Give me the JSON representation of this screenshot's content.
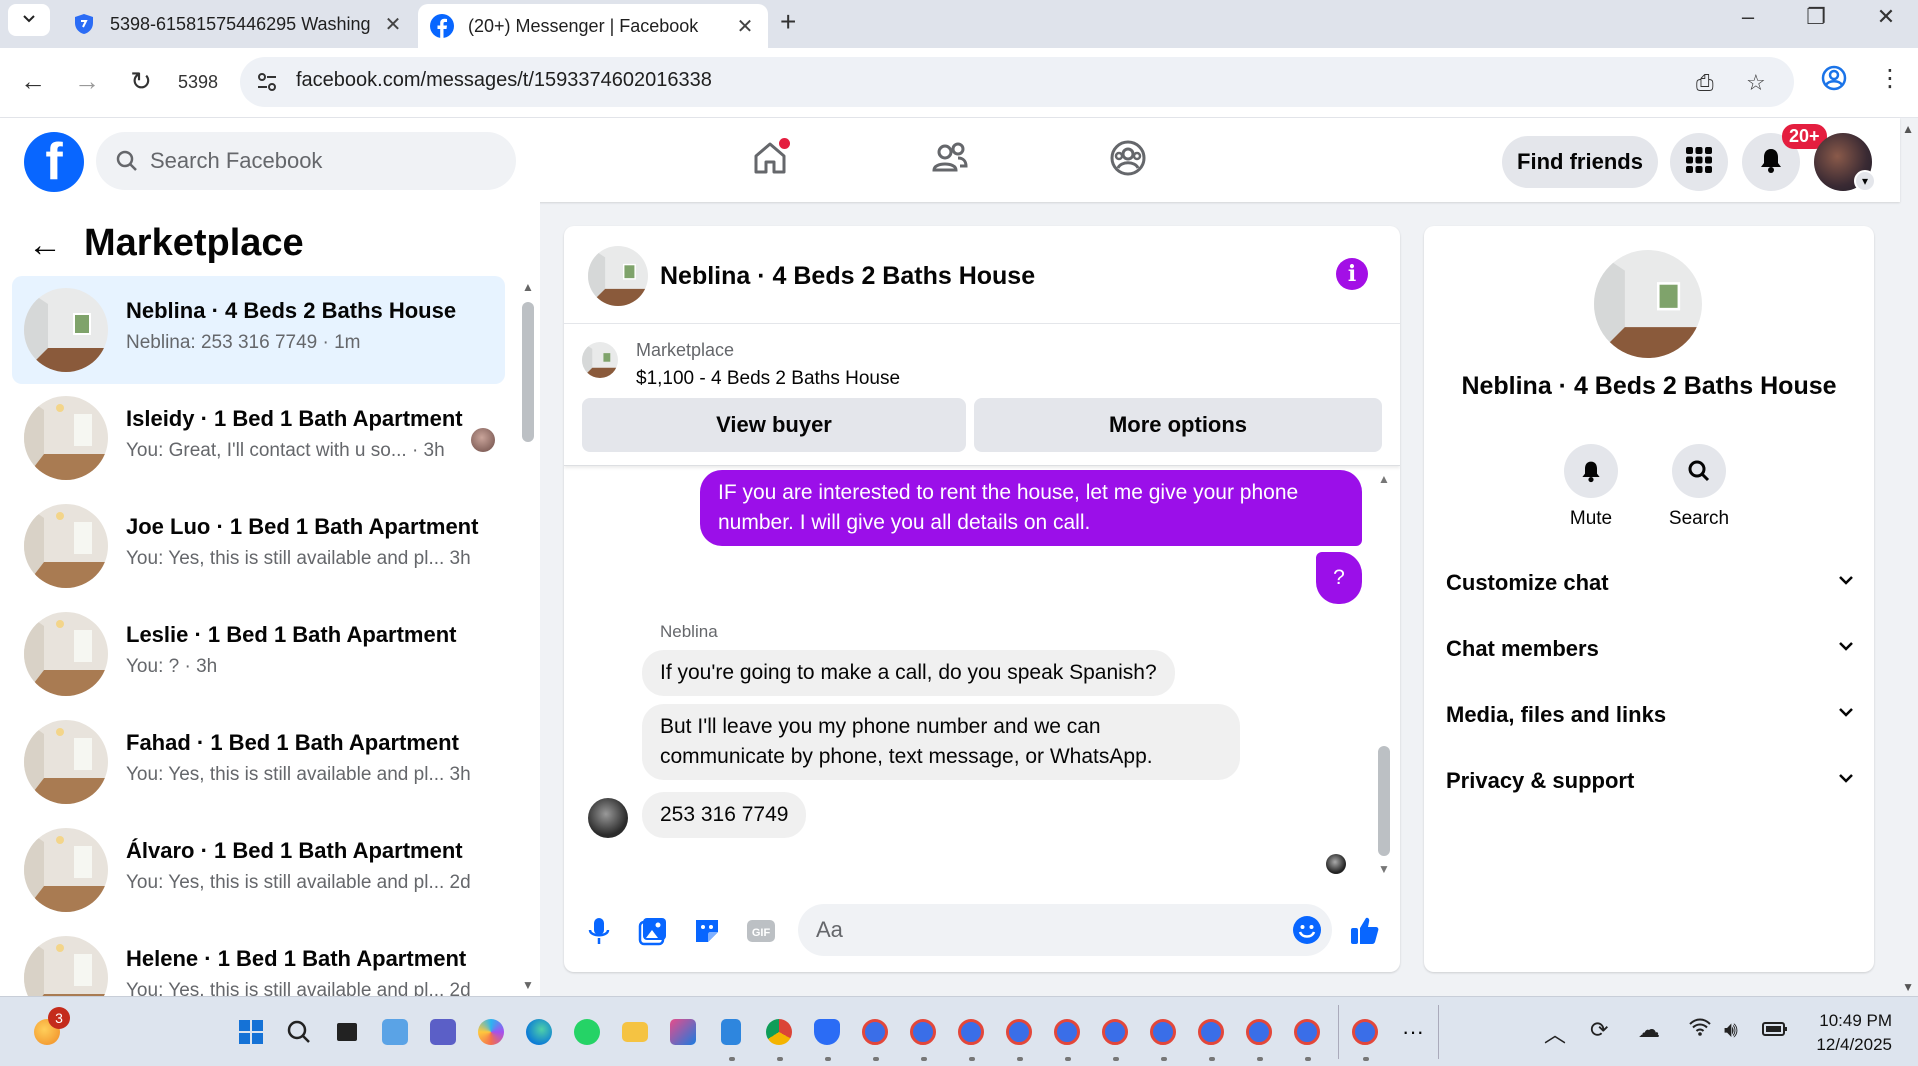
{
  "browser": {
    "tabs": [
      {
        "title": "5398-61581575446295 Washing",
        "active": false
      },
      {
        "title": "(20+) Messenger | Facebook",
        "active": true
      }
    ],
    "profile_label": "5398",
    "url": "facebook.com/messages/t/1593374602016338",
    "new_tab_glyph": "+",
    "close_glyph": "✕"
  },
  "facebook": {
    "logo_letter": "f",
    "search_placeholder": "Search Facebook",
    "find_friends_label": "Find friends",
    "notification_badge": "20+",
    "brand_color": "#0866ff"
  },
  "sidebar": {
    "title": "Marketplace",
    "conversations": [
      {
        "name": "Neblina · 4 Beds 2 Baths House",
        "preview": "Neblina: 253 316 7749 · 1m",
        "active": true
      },
      {
        "name": "Isleidy · 1 Bed 1 Bath Apartment",
        "preview": "You: Great, I'll contact with u so...  · 3h",
        "seen": true
      },
      {
        "name": "Joe Luo · 1 Bed 1 Bath Apartment",
        "preview": "You: Yes, this is still available and pl...  3h"
      },
      {
        "name": "Leslie · 1 Bed 1 Bath Apartment",
        "preview": "You: ? · 3h"
      },
      {
        "name": "Fahad · 1 Bed 1 Bath Apartment",
        "preview": "You: Yes, this is still available and pl...  3h"
      },
      {
        "name": "Álvaro · 1 Bed 1 Bath Apartment",
        "preview": "You: Yes, this is still available and pl...  2d"
      },
      {
        "name": "Helene · 1 Bed 1 Bath Apartment",
        "preview": "You: Yes, this is still available and pl...  2d"
      }
    ]
  },
  "chat": {
    "title": "Neblina · 4 Beds 2 Baths House",
    "listing": {
      "kind": "Marketplace",
      "price_line": "$1,100 - 4 Beds 2 Baths House",
      "view_buyer_label": "View buyer",
      "more_options_label": "More options"
    },
    "messages": {
      "outgoing_1": "IF you are interested to rent the house, let me give your phone number. I will give you all details on call.",
      "outgoing_2": "?",
      "sender_name": "Neblina",
      "incoming_1": "If you're going to make a call, do you speak Spanish?",
      "incoming_2": "But I'll leave you my phone number and we can communicate by phone, text message, or WhatsApp.",
      "incoming_3": "253 316 7749"
    },
    "composer_placeholder": "Aa",
    "gif_label": "GIF",
    "accent_color": "#9b0fe9"
  },
  "details": {
    "title": "Neblina · 4 Beds 2 Baths House",
    "actions": [
      {
        "label": "Mute"
      },
      {
        "label": "Search"
      }
    ],
    "sections": [
      "Customize chat",
      "Chat members",
      "Media, files and links",
      "Privacy & support"
    ]
  },
  "taskbar": {
    "badge": "3",
    "clock_time": "10:49 PM",
    "clock_date": "12/4/2025",
    "more_label": "···"
  }
}
